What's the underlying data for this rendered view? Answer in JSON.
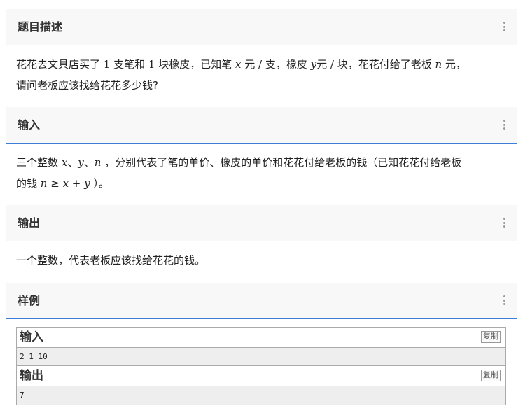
{
  "description": {
    "title": "题目描述",
    "text_a": "花花去文具店买了 ",
    "num_1a": "1",
    "text_b": " 支笔和 ",
    "num_1b": "1",
    "text_c": " 块橡皮，已知笔 ",
    "var_x": "x",
    "text_d": " 元",
    "slash_1": " / ",
    "text_e": "支，橡皮 ",
    "var_y": "y",
    "text_f": "元",
    "slash_2": " / ",
    "text_g": "块，花花付给了老板 ",
    "var_n": "n",
    "text_h": " 元，",
    "line2": "请问老板应该找给花花多少钱?"
  },
  "input": {
    "title": "输入",
    "text_a": "三个整数 ",
    "var_x": "x",
    "sep_1": "、",
    "var_y": "y",
    "sep_2": "、",
    "var_n": "n",
    "text_b": " ，分别代表了笔的单价、橡皮的单价和花花付给老板的钱（已知花花付给老板",
    "text_c": "的钱 ",
    "math_n": "n",
    "math_ge": " ≥ ",
    "math_x": "x",
    "math_plus": " + ",
    "math_y": "y",
    "text_d": " ）。"
  },
  "output": {
    "title": "输出",
    "text": "一个整数，代表老板应该找给花花的钱。"
  },
  "samples": {
    "title": "样例",
    "input_label": "输入",
    "input_copy": "复制",
    "input_data": "2 1 10",
    "output_label": "输出",
    "output_copy": "复制",
    "output_data": "7"
  },
  "colors": {
    "accent": "#3d7fd6",
    "header_bg": "#f8f8f8",
    "sample_bg": "#eeeeee"
  },
  "icons": {
    "section_menu": "kebab-icon"
  }
}
